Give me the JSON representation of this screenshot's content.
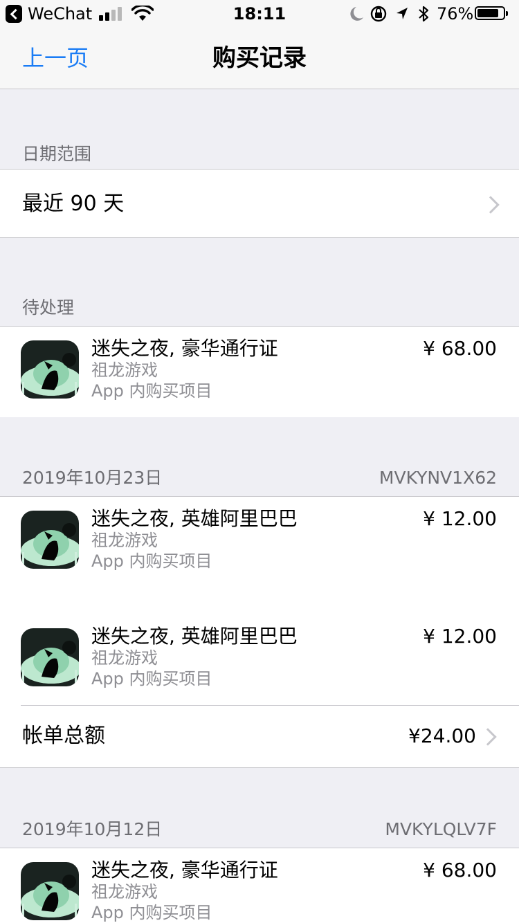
{
  "status_bar": {
    "app": "WeChat",
    "time": "18:11",
    "battery": "76%",
    "signal_bars": 4,
    "signal_bars_filled": 2
  },
  "nav": {
    "back": "上一页",
    "title": "购买记录"
  },
  "date_range": {
    "header": "日期范围",
    "value": "最近 90 天"
  },
  "pending": {
    "header": "待处理",
    "item": {
      "title": "迷失之夜, 豪华通行证",
      "developer": "祖龙游戏",
      "type": "App 内购买项目",
      "price": "¥ 68.00"
    }
  },
  "orders": [
    {
      "date": "2019年10月23日",
      "order_id": "MVKYNV1X62",
      "items": [
        {
          "title": "迷失之夜, 英雄阿里巴巴",
          "developer": "祖龙游戏",
          "type": "App 内购买项目",
          "price": "¥ 12.00"
        },
        {
          "title": "迷失之夜, 英雄阿里巴巴",
          "developer": "祖龙游戏",
          "type": "App 内购买项目",
          "price": "¥ 12.00"
        }
      ],
      "total_label": "帐单总额",
      "total": "¥24.00"
    },
    {
      "date": "2019年10月12日",
      "order_id": "MVKYLQLV7F",
      "items": [
        {
          "title": "迷失之夜, 豪华通行证",
          "developer": "祖龙游戏",
          "type": "App 内购买项目",
          "price": "¥ 68.00"
        }
      ]
    }
  ],
  "colors": {
    "accent": "#1a7cf5",
    "background": "#efeff4",
    "secondary_text": "#8e8e93",
    "separator": "#c8c7cc"
  }
}
